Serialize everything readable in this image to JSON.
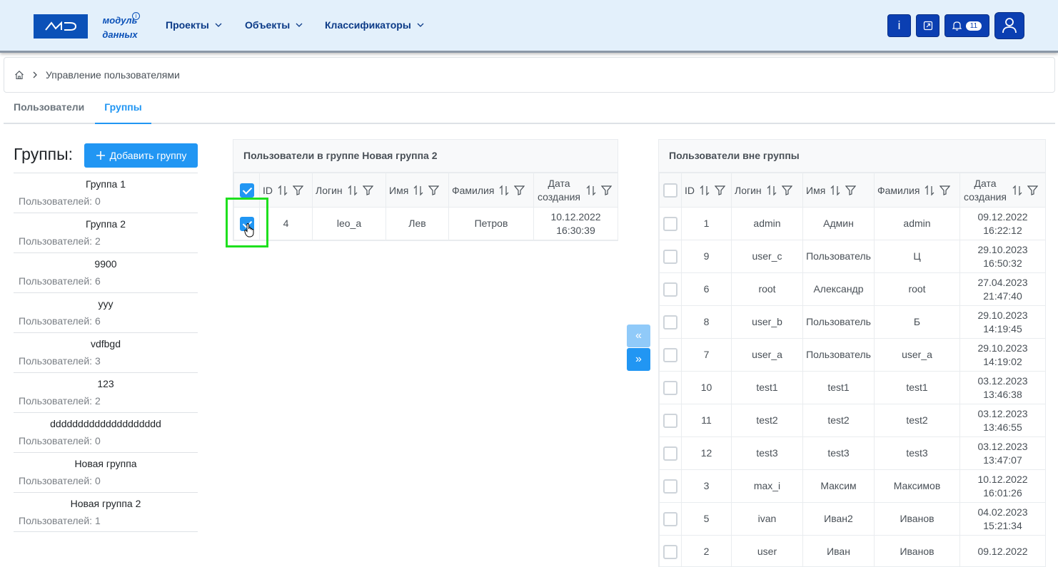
{
  "header": {
    "logo_mark": "MD",
    "logo_line1": "модуль",
    "logo_line2": "данных",
    "logo_info": "i",
    "nav": [
      {
        "label": "Проекты"
      },
      {
        "label": "Объекты"
      },
      {
        "label": "Классификаторы"
      }
    ],
    "info_button": "i",
    "notification_count": "11"
  },
  "breadcrumb": {
    "current": "Управление пользователями"
  },
  "tabs": [
    {
      "label": "Пользователи",
      "active": false
    },
    {
      "label": "Группы",
      "active": true
    }
  ],
  "groups_panel": {
    "title": "Группы:",
    "add_button": "Добавить группу",
    "items": [
      {
        "name": "Группа 1",
        "count": "Пользователей: 0"
      },
      {
        "name": "Группа 2",
        "count": "Пользователей: 2"
      },
      {
        "name": "9900",
        "count": "Пользователей: 6"
      },
      {
        "name": "yyy",
        "count": "Пользователей: 6"
      },
      {
        "name": "vdfbgd",
        "count": "Пользователей: 3"
      },
      {
        "name": "123",
        "count": "Пользователей: 2"
      },
      {
        "name": "dddddddddddddddddddd",
        "count": "Пользователей: 0"
      },
      {
        "name": "Новая группа",
        "count": "Пользователей: 0"
      },
      {
        "name": "Новая группа 2",
        "count": "Пользователей: 1"
      }
    ]
  },
  "in_group_table": {
    "title": "Пользователи в группе Новая группа 2",
    "columns": [
      "ID",
      "Логин",
      "Имя",
      "Фамилия",
      "Дата создания"
    ],
    "rows": [
      {
        "id": "4",
        "login": "leo_a",
        "name": "Лев",
        "surname": "Петров",
        "date": "10.12.2022",
        "time": "16:30:39",
        "checked": true
      }
    ]
  },
  "move_buttons": {
    "left": "«",
    "right": "»"
  },
  "out_group_table": {
    "title": "Пользователи вне группы",
    "columns": [
      "ID",
      "Логин",
      "Имя",
      "Фамилия",
      "Дата создания"
    ],
    "rows": [
      {
        "id": "1",
        "login": "admin",
        "name": "Админ",
        "surname": "admin",
        "date": "09.12.2022",
        "time": "16:22:12"
      },
      {
        "id": "9",
        "login": "user_c",
        "name": "Пользователь",
        "surname": "Ц",
        "date": "29.10.2023",
        "time": "16:50:32"
      },
      {
        "id": "6",
        "login": "root",
        "name": "Александр",
        "surname": "root",
        "date": "27.04.2023",
        "time": "21:47:40"
      },
      {
        "id": "8",
        "login": "user_b",
        "name": "Пользователь",
        "surname": "Б",
        "date": "29.10.2023",
        "time": "14:19:45"
      },
      {
        "id": "7",
        "login": "user_a",
        "name": "Пользователь",
        "surname": "user_a",
        "date": "29.10.2023",
        "time": "14:19:02"
      },
      {
        "id": "10",
        "login": "test1",
        "name": "test1",
        "surname": "test1",
        "date": "03.12.2023",
        "time": "13:46:38"
      },
      {
        "id": "11",
        "login": "test2",
        "name": "test2",
        "surname": "test2",
        "date": "03.12.2023",
        "time": "13:46:55"
      },
      {
        "id": "12",
        "login": "test3",
        "name": "test3",
        "surname": "test3",
        "date": "03.12.2023",
        "time": "13:47:07"
      },
      {
        "id": "3",
        "login": "max_i",
        "name": "Максим",
        "surname": "Максимов",
        "date": "10.12.2022",
        "time": "16:01:26"
      },
      {
        "id": "5",
        "login": "ivan",
        "name": "Иван2",
        "surname": "Иванов",
        "date": "04.02.2023",
        "time": "15:21:34"
      },
      {
        "id": "2",
        "login": "user",
        "name": "Иван",
        "surname": "Иванов",
        "date": "09.12.2022",
        "time": ""
      }
    ]
  },
  "colors": {
    "primary": "#2196f3",
    "brand": "#0b51b8",
    "header_bg": "#e3f0fb",
    "highlight": "#1ee01e"
  }
}
